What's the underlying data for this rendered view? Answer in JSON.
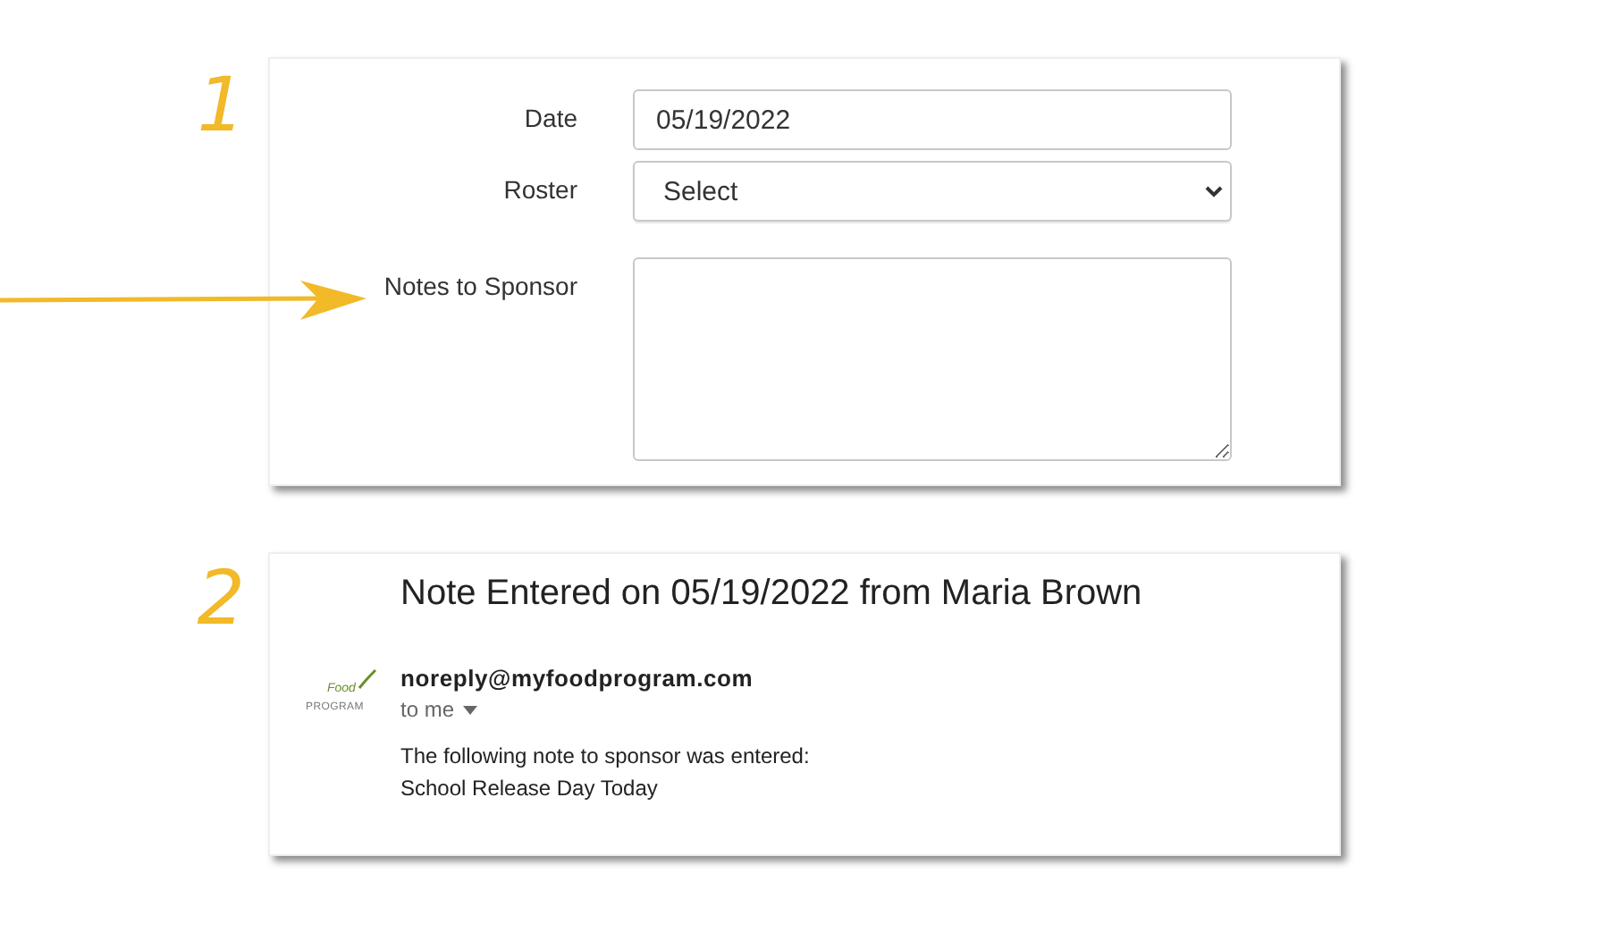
{
  "steps": [
    {
      "number": "1",
      "form": {
        "fields": [
          {
            "kind": "text",
            "label": "Date",
            "value": "05/19/2022"
          },
          {
            "kind": "select",
            "label": "Roster",
            "value": "Select"
          },
          {
            "kind": "textarea",
            "label": "Notes to Sponsor"
          }
        ]
      }
    },
    {
      "number": "2",
      "email": {
        "subject": "Note Entered on 05/19/2022 from Maria Brown",
        "logo_text": [
          "Food",
          "PROGRAM"
        ],
        "sender": "noreply@myfoodprogram.com",
        "recipient": "to me",
        "body": [
          "The following note to sponsor was entered:",
          "School Release Day Today"
        ]
      }
    }
  ]
}
